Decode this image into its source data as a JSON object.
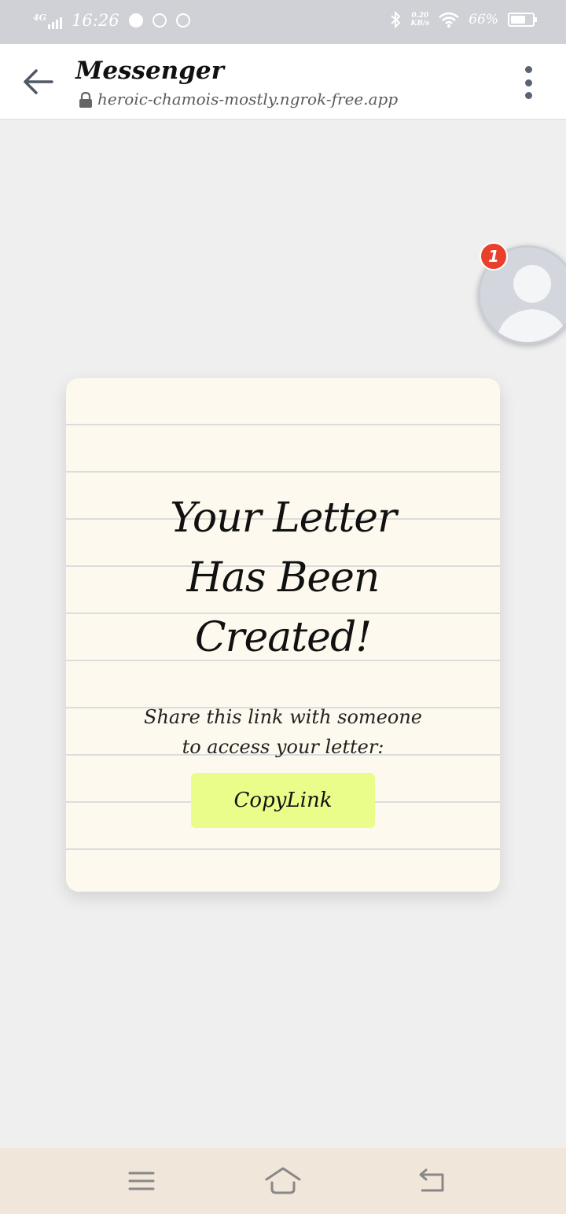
{
  "status_bar": {
    "network": "4G",
    "time": "16:26",
    "speed_value": "0.20",
    "speed_unit": "KB/s",
    "battery": "66%"
  },
  "header": {
    "title": "Messenger",
    "url": "heroic-chamois-mostly.ngrok-free.app"
  },
  "chathead": {
    "badge_count": "1"
  },
  "letter": {
    "title_line1": "Your Letter",
    "title_line2": "Has Been",
    "title_line3": "Created!",
    "text_line1": "Share this link with someone",
    "text_line2": "to access your letter:",
    "button_label": "CopyLink"
  },
  "colors": {
    "button": "#eafc8a",
    "card": "#fdf9ee",
    "badge": "#e8402d"
  }
}
